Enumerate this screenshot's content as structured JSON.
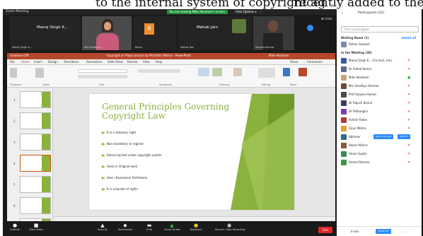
{
  "doc_fragment": {
    "left": "to the internal system of copyright ag",
    "right": "recently added to the Copyright Act by"
  },
  "zoom": {
    "meeting_info": "Zoom Meeting",
    "sharing_banner": "You are viewing Mike Abraham's screen",
    "view_options": "View Options ▾"
  },
  "video_strip": [
    {
      "name": "Manoj Singh K...",
      "label": "Manoj Singh K..."
    },
    {
      "label": "Mrs Sandhya..."
    },
    {
      "initial": "R",
      "label": "Rahul"
    },
    {
      "name": "Mehak Jain",
      "label": "Mehak Jain"
    },
    {
      "label": "Sanjeev Kumar"
    }
  ],
  "video_strip_toggle": "⊞ Hide",
  "ppt": {
    "autosave": "AutoSave  Off",
    "title": "Copyright on Plays Lecture by Ms Itishri Mishra - PowerPoint",
    "user": "Mike Abraham",
    "tabs": [
      "File",
      "Home",
      "Insert",
      "Design",
      "Transitions",
      "Animations",
      "Slide Show",
      "Review",
      "View",
      "Help"
    ],
    "share": "Share",
    "comments": "Comments",
    "groups": [
      "Clipboard",
      "Slides",
      "Font",
      "Paragraph",
      "Drawing",
      "Editing",
      "Voice"
    ]
  },
  "thumbs": [
    "1",
    "2",
    "3",
    "4",
    "5",
    "6",
    "7"
  ],
  "slide": {
    "title": "General Principles Governing Copyright Law",
    "bullets": [
      "It is a statutory right",
      "Not mandatory to register",
      "Balancing test under copyright system",
      "Vests in Original work",
      "Idea—Expression Dichotomy",
      "It is a bundle of rights"
    ]
  },
  "controls": [
    "Unmute",
    "Start Video",
    "Security",
    "Participants",
    "Chat",
    "Share Screen",
    "Reactions",
    "Record / Stop Recording",
    "End"
  ],
  "panel": {
    "collapse": "⌄",
    "title": "Participants (31)",
    "search_placeholder": "Find a participant",
    "waiting_header": "Waiting Room (1)",
    "admit_all": "Admit all",
    "waiting": [
      "Rohan Gautam"
    ],
    "in_meeting_header": "In the Meeting (30)",
    "participants": [
      "Manoj Singh K... (Co-host, me)",
      "Dr Ashok Kumar",
      "Mike Abraham",
      "Mrs Sandhya Sharma",
      "Prof Sanjeev Kumar",
      "Dr Rajesh Kumar",
      "Dr Shibangini",
      "Ashish Yadav",
      "Arjun Mehra",
      "Abhinav",
      "Akash Mishra",
      "Aman Gupta",
      "Anand Sharma"
    ],
    "ask_unmute": "Ask to Unmute",
    "more": "More ▾",
    "invite": "Invite",
    "mute_all": "Mute All",
    "footer_more": "..."
  }
}
